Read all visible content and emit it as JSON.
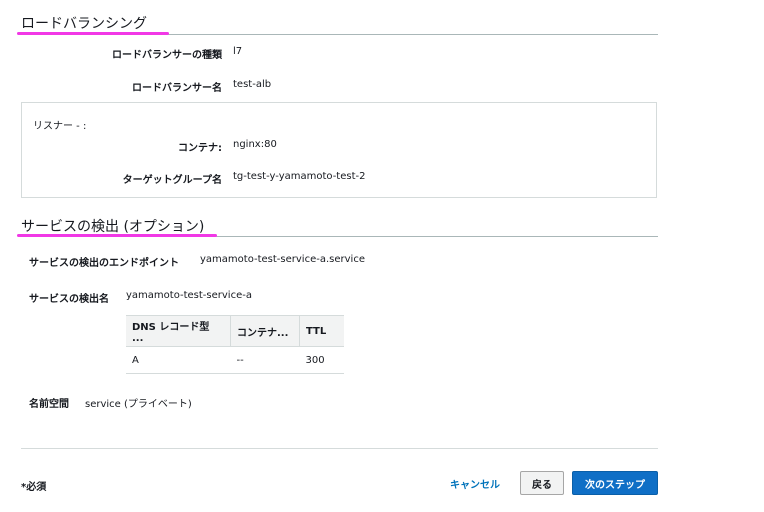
{
  "load_balancing": {
    "title": "ロードバランシング",
    "type_label": "ロードバランサーの種類",
    "type_value": "l7",
    "name_label": "ロードバランサー名",
    "name_value": "test-alb",
    "listener": {
      "title": "リスナー - :",
      "container_label": "コンテナ:",
      "container_value": "nginx:80",
      "target_group_label": "ターゲットグループ名",
      "target_group_value": "tg-test-y-yamamoto-test-2"
    }
  },
  "service_discovery": {
    "title": "サービスの検出 (オプション)",
    "endpoint_label": "サービスの検出のエンドポイント",
    "endpoint_value": "yamamoto-test-service-a.service",
    "name_label": "サービスの検出名",
    "name_value": "yamamoto-test-service-a",
    "table": {
      "headers": [
        "DNS レコード型 ...",
        "コンテナ...",
        "TTL"
      ],
      "rows": [
        [
          "A",
          "--",
          "300"
        ]
      ]
    },
    "namespace_label": "名前空間",
    "namespace_value": "service (プライベート)"
  },
  "footer": {
    "required_note": "*必須",
    "cancel_label": "キャンセル",
    "back_label": "戻る",
    "next_label": "次のステップ"
  },
  "colors": {
    "accent_underline": "#f138e6",
    "primary_button": "#0f6fc6",
    "link": "#0073bb"
  }
}
